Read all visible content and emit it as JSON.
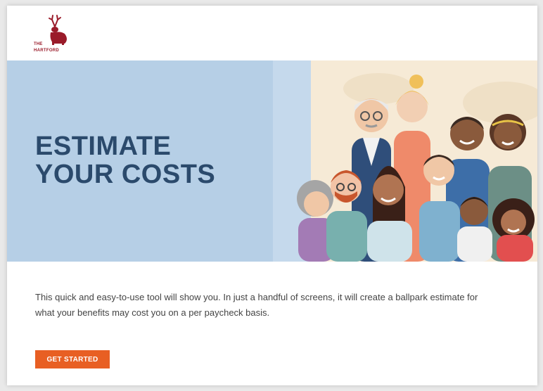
{
  "brand": {
    "line1": "THE",
    "line2": "HARTFORD",
    "logo_icon": "stag-icon",
    "color": "#9a1b2a"
  },
  "hero": {
    "title_line1": "ESTIMATE",
    "title_line2": "YOUR COSTS",
    "panel_color": "#b6cfe6",
    "title_color": "#2b4a6c",
    "illustration": "group-of-people-illustration"
  },
  "intro": {
    "text": "This quick and easy-to-use tool will show you. In just a handful of screens, it will create a ballpark estimate for what your benefits may cost you on a per paycheck basis."
  },
  "cta": {
    "label": "GET STARTED",
    "color": "#e85f23"
  }
}
